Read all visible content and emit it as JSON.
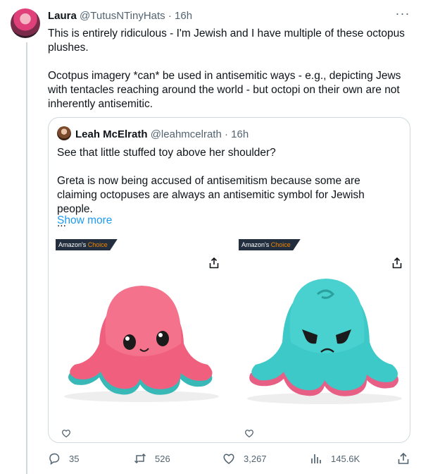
{
  "tweet": {
    "author_name": "Laura",
    "author_handle": "@TutusNTinyHats",
    "separator": "·",
    "time": "16h",
    "more_label": "···",
    "paragraphs": [
      "This is entirely ridiculous - I'm Jewish and I have multiple of these octopus plushes.",
      "Ocotpus imagery *can* be used in antisemitic  ways - e.g., depicting Jews with tentacles reaching around the world - but octopi on their own are not inherently antisemitic."
    ]
  },
  "quote": {
    "author_name": "Leah McElrath",
    "author_handle": "@leahmcelrath",
    "separator": "·",
    "time": "16h",
    "line1": "See that little stuffed toy above her shoulder?",
    "line2": "Greta is now being accused of antisemitism because some are claiming octopuses are always an antisemitic symbol for Jewish people.",
    "ellipsis": "...",
    "show_more": "Show more",
    "media": [
      {
        "badge_prefix": "Amazon's ",
        "badge_highlight": "Choice",
        "color": "pink"
      },
      {
        "badge_prefix": "Amazon's ",
        "badge_highlight": "Choice",
        "color": "teal"
      }
    ]
  },
  "actions": {
    "reply_count": "35",
    "retweet_count": "526",
    "like_count": "3,267",
    "views_count": "145.6K"
  },
  "colors": {
    "link": "#1d9bf0",
    "muted": "#536471",
    "border": "#cfd9de",
    "pink_octopus": "#f0607e",
    "teal_octopus": "#3cc9c8"
  },
  "icons": [
    "more-icon",
    "share-icon",
    "heart-icon",
    "reply-icon",
    "retweet-icon",
    "like-icon",
    "views-icon",
    "share-tweet-icon"
  ]
}
